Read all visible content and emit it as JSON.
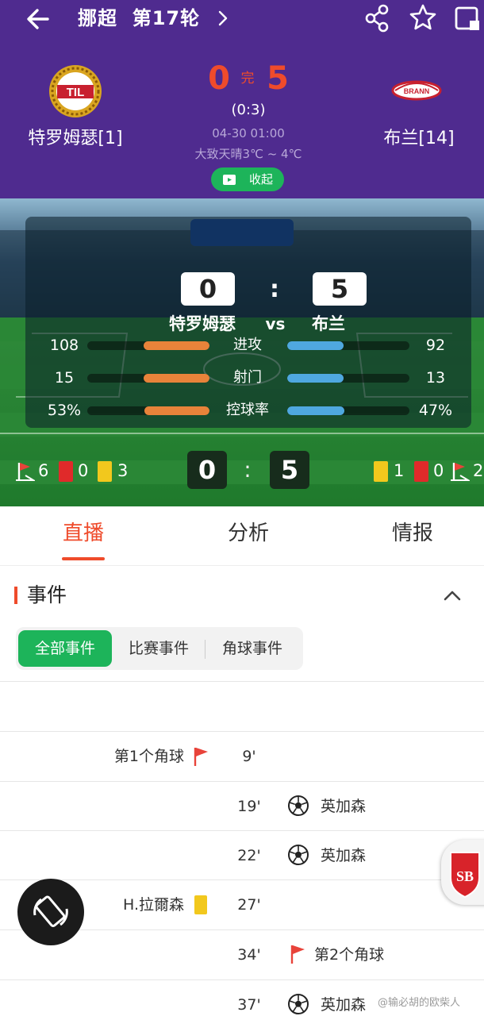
{
  "header": {
    "league": "挪超",
    "round": "第17轮",
    "home_team": "特罗姆瑟[1]",
    "away_team": "布兰[14]",
    "home_logo_text": "TIL",
    "away_logo_text": "BRANN",
    "home_score": "0",
    "away_score": "5",
    "status": "完",
    "halftime": "(0:3)",
    "kickoff": "04-30 01:00",
    "weather": "大致天晴3℃ ~ 4℃",
    "collapse_label": "收起",
    "colors": {
      "bg": "#4f2b8f",
      "score": "#ef4b2b",
      "accent": "#1db45a"
    }
  },
  "stats_card": {
    "home_score": "0",
    "away_score": "5",
    "separator": ":",
    "home_name": "特罗姆瑟",
    "vs": "vs",
    "away_name": "布兰",
    "rows": [
      {
        "label": "进攻",
        "home": "108",
        "away": "92"
      },
      {
        "label": "射门",
        "home": "15",
        "away": "13"
      },
      {
        "label": "控球率",
        "home": "53%",
        "away": "47%"
      }
    ]
  },
  "strip": {
    "home_corners": "6",
    "home_red": "0",
    "home_yellow": "3",
    "home_score": "0",
    "separator": ":",
    "away_score": "5",
    "away_yellow": "1",
    "away_red": "0",
    "away_corners": "2"
  },
  "tabs": [
    {
      "label": "直播",
      "active": true
    },
    {
      "label": "分析",
      "active": false
    },
    {
      "label": "情报",
      "active": false
    }
  ],
  "events": {
    "title": "事件",
    "filters": [
      "全部事件",
      "比赛事件",
      "角球事件"
    ],
    "items": [
      {
        "minute": "9'",
        "side": "home",
        "text": "第1个角球",
        "icon": "corner-flag-icon"
      },
      {
        "minute": "19'",
        "side": "away",
        "text": "英加森",
        "icon": "soccer-ball-icon"
      },
      {
        "minute": "22'",
        "side": "away",
        "text": "英加森",
        "icon": "soccer-ball-icon"
      },
      {
        "minute": "27'",
        "side": "home",
        "text": "H.拉爾森",
        "icon": "yellow-card-icon"
      },
      {
        "minute": "34'",
        "side": "away",
        "text": "第2个角球",
        "icon": "corner-flag-icon"
      },
      {
        "minute": "37'",
        "side": "away",
        "text": "英加森",
        "icon": "soccer-ball-icon"
      }
    ]
  },
  "side_badge_text": "SB",
  "watermark": "@输必胡的欧柴人"
}
